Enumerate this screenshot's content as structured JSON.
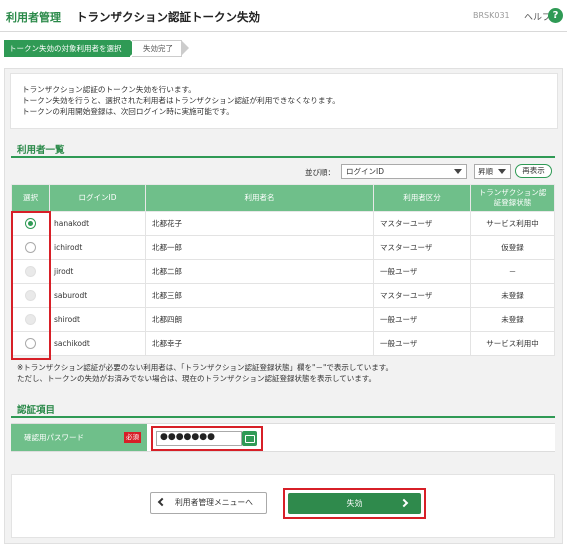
{
  "header": {
    "section": "利用者管理",
    "title": "トランザクション認証トークン失効",
    "screen_code": "BRSK031",
    "help_label": "ヘルプ",
    "help_icon_glyph": "?"
  },
  "steps": [
    {
      "label": "トークン失効の対象利用者を選択",
      "active": true
    },
    {
      "label": "失効完了",
      "active": false
    }
  ],
  "intro": {
    "lines": [
      "トランザクション認証のトークン失効を行います。",
      "トークン失効を行うと、選択された利用者はトランザクション認証が利用できなくなります。",
      "トークンの利用開始登録は、次回ログイン時に実施可能です。"
    ]
  },
  "users_section": {
    "heading": "利用者一覧",
    "sort_label": "並び順：",
    "sort_value": "ログインID",
    "order_value": "昇順",
    "redisplay_label": "再表示",
    "columns": [
      "選択",
      "ログインID",
      "利用者名",
      "利用者区分",
      "トランザクション認証登録状態"
    ],
    "rows": [
      {
        "selected": true,
        "enabled": true,
        "login_id": "hanakodt",
        "name": "北都花子",
        "type": "マスターユーザ",
        "status": "サービス利用中"
      },
      {
        "selected": false,
        "enabled": true,
        "login_id": "ichirodt",
        "name": "北都一郎",
        "type": "マスターユーザ",
        "status": "仮登録"
      },
      {
        "selected": false,
        "enabled": false,
        "login_id": "jirodt",
        "name": "北都二郎",
        "type": "一般ユーザ",
        "status": "－"
      },
      {
        "selected": false,
        "enabled": false,
        "login_id": "saburodt",
        "name": "北都三郎",
        "type": "マスターユーザ",
        "status": "未登録"
      },
      {
        "selected": false,
        "enabled": false,
        "login_id": "shirodt",
        "name": "北都四朗",
        "type": "一般ユーザ",
        "status": "未登録"
      },
      {
        "selected": false,
        "enabled": true,
        "login_id": "sachikodt",
        "name": "北都幸子",
        "type": "一般ユーザ",
        "status": "サービス利用中"
      }
    ],
    "notes": [
      "※トランザクション認証が必要のない利用者は、「トランザクション認証登録状態」欄を\"－\"で表示しています。",
      "ただし、トークンの失効がお済みでない場合は、現在のトランザクション認証登録状態を表示しています。"
    ]
  },
  "auth_section": {
    "heading": "認証項目",
    "password_label": "確認用パスワード",
    "required_badge": "必須",
    "password_value": "●●●●●●●"
  },
  "actions": {
    "back_label": "利用者管理メニューへ",
    "submit_label": "失効"
  },
  "colors": {
    "accent": "#2f9a55",
    "header_cell": "#6fbf8a",
    "highlight": "#d71f27"
  }
}
